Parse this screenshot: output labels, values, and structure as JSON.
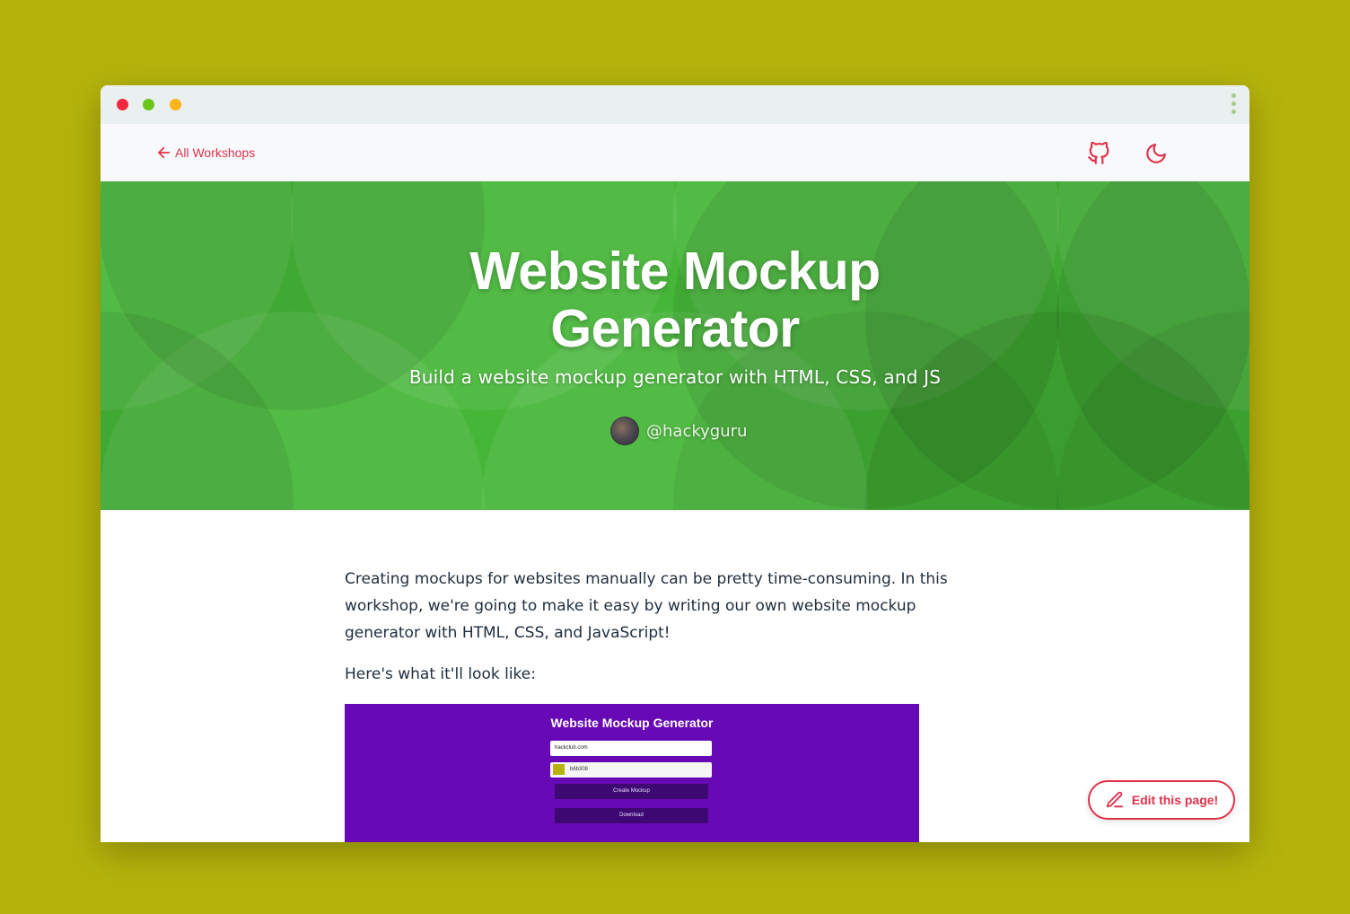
{
  "window": {
    "controls": [
      "close",
      "minimize",
      "maximize"
    ],
    "menu_icon": "kebab-icon"
  },
  "nav": {
    "back_label": "All Workshops",
    "back_icon": "arrow-left-icon",
    "github_icon": "github-icon",
    "theme_icon": "moon-icon"
  },
  "hero": {
    "title_line1": "Website Mockup",
    "title_line2": "Generator",
    "subtitle": "Build a website mockup generator with HTML, CSS, and JS",
    "author": "@hackyguru",
    "background_color": "#45b637"
  },
  "content": {
    "intro": "Creating mockups for websites manually can be pretty time-consuming. In this workshop, we're going to make it easy by writing our own website mockup generator with HTML, CSS, and JavaScript!",
    "preview_intro": "Here's what it'll look like:"
  },
  "preview": {
    "title": "Website Mockup Generator",
    "url_value": "hackclub.com",
    "color_value": "b6b308",
    "create_label": "Create Mockup",
    "download_label": "Download",
    "background_color": "#6709b4"
  },
  "edit": {
    "label": "Edit this page!",
    "icon": "pencil-icon"
  },
  "colors": {
    "accent": "#e0324b",
    "page_background": "#b5b30b"
  }
}
